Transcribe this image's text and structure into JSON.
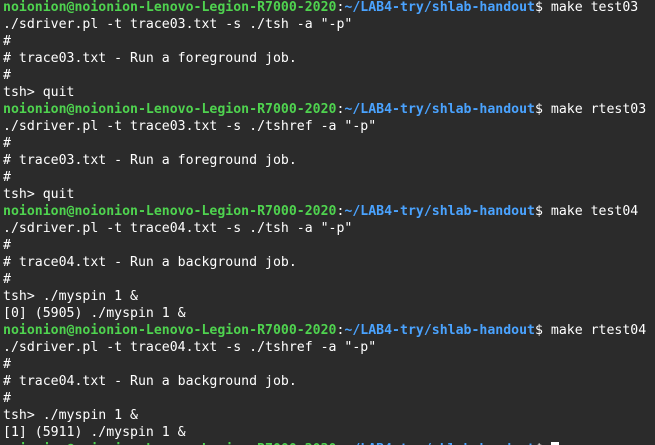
{
  "prompt": {
    "user_host": "noionion@noionion-Lenovo-Legion-R7000-2020",
    "colon": ":",
    "path": "~/LAB4-try/shlab-handout",
    "dollar": "$ "
  },
  "lines": [
    {
      "type": "prompt",
      "cmd": "make test03"
    },
    {
      "type": "text",
      "text": "./sdriver.pl -t trace03.txt -s ./tsh -a \"-p\""
    },
    {
      "type": "text",
      "text": "#"
    },
    {
      "type": "text",
      "text": "# trace03.txt - Run a foreground job."
    },
    {
      "type": "text",
      "text": "#"
    },
    {
      "type": "text",
      "text": "tsh> quit"
    },
    {
      "type": "prompt",
      "cmd": "make rtest03"
    },
    {
      "type": "text",
      "text": "./sdriver.pl -t trace03.txt -s ./tshref -a \"-p\""
    },
    {
      "type": "text",
      "text": "#"
    },
    {
      "type": "text",
      "text": "# trace03.txt - Run a foreground job."
    },
    {
      "type": "text",
      "text": "#"
    },
    {
      "type": "text",
      "text": "tsh> quit"
    },
    {
      "type": "prompt",
      "cmd": "make test04"
    },
    {
      "type": "text",
      "text": "./sdriver.pl -t trace04.txt -s ./tsh -a \"-p\""
    },
    {
      "type": "text",
      "text": "#"
    },
    {
      "type": "text",
      "text": "# trace04.txt - Run a background job."
    },
    {
      "type": "text",
      "text": "#"
    },
    {
      "type": "text",
      "text": "tsh> ./myspin 1 &"
    },
    {
      "type": "text",
      "text": "[0] (5905) ./myspin 1 &"
    },
    {
      "type": "prompt",
      "cmd": "make rtest04"
    },
    {
      "type": "text",
      "text": "./sdriver.pl -t trace04.txt -s ./tshref -a \"-p\""
    },
    {
      "type": "text",
      "text": "#"
    },
    {
      "type": "text",
      "text": "# trace04.txt - Run a background job."
    },
    {
      "type": "text",
      "text": "#"
    },
    {
      "type": "text",
      "text": "tsh> ./myspin 1 &"
    },
    {
      "type": "text",
      "text": "[1] (5911) ./myspin 1 &"
    },
    {
      "type": "prompt",
      "cmd": "",
      "cursor": true
    }
  ]
}
